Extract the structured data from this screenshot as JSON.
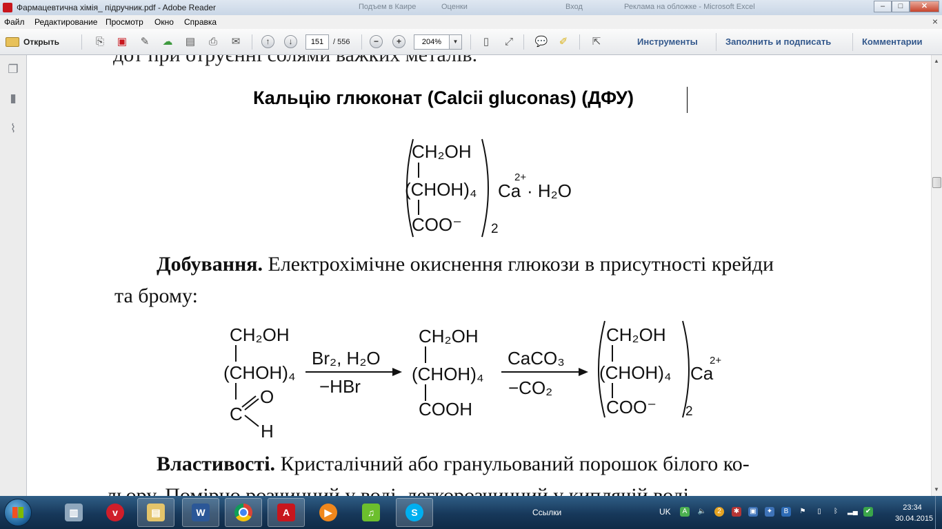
{
  "window": {
    "title": "Фармацевтична хімія_ підручник.pdf - Adobe Reader",
    "ghost_tabs": [
      "Подъем в Каире",
      "Оценки",
      "Вход",
      "Реклама на обложке - Microsoft Excel"
    ]
  },
  "menu": {
    "items": [
      "Файл",
      "Редактирование",
      "Просмотр",
      "Окно",
      "Справка"
    ],
    "close": "×"
  },
  "toolbar": {
    "open_label": "Открыть",
    "page_current": "151",
    "page_total": "/ 556",
    "zoom": "204%",
    "links": [
      "Инструменты",
      "Заполнить и подписать",
      "Комментарии"
    ]
  },
  "document": {
    "cut_line": "дот при отруєнні солями важких металів.",
    "heading": "Кальцію глюконат (Calcii gluconas) (ДФУ)",
    "formula": {
      "ch2oh": "CH₂OH",
      "chohn": "(CHOH)₄",
      "coo": "COO⁻",
      "ca": "Ca",
      "charge": "2+",
      "water": "· H₂O",
      "index": "2"
    },
    "production_label": "Добування.",
    "production_text": " Електрохімічне окиснення глюкози в присутності крейди",
    "production_text2": "та  брому:",
    "reaction": {
      "r1_ch2oh": "CH₂OH",
      "r1_choh": "(CHOH)₄",
      "r1_c": "C",
      "r1_o": "O",
      "r1_h": "H",
      "arrow1_top": "Br₂, H₂O",
      "arrow1_bottom": "−HBr",
      "r2_ch2oh": "CH₂OH",
      "r2_choh": "(CHOH)₄",
      "r2_cooh": "COOH",
      "arrow2_top": "CaCO₃",
      "arrow2_bottom": "−CO₂",
      "r3_ch2oh": "CH₂OH",
      "r3_choh": "(CHOH)₄",
      "r3_coo": "COO⁻",
      "r3_ca": "Ca",
      "r3_charge": "2+",
      "r3_index": "2"
    },
    "properties_label": "Властивості.",
    "properties_text": " Кристалічний або гранульований порошок білого ко-",
    "properties_text2": "льору. Помірно розчинний у воді, легкорозчинний у киплячій воді"
  },
  "taskbar": {
    "links_label": "Ссылки",
    "lang": "UK",
    "time": "23:34",
    "date": "30.04.2015",
    "apps": [
      "file-manager",
      "virgin-mobile",
      "explorer",
      "word",
      "chrome",
      "adobe-reader",
      "media-player",
      "music",
      "skype"
    ]
  },
  "colors": {
    "toolbar_link": "#33588c",
    "taskbar": "#17385a",
    "acrobat_red": "#c8161d"
  }
}
